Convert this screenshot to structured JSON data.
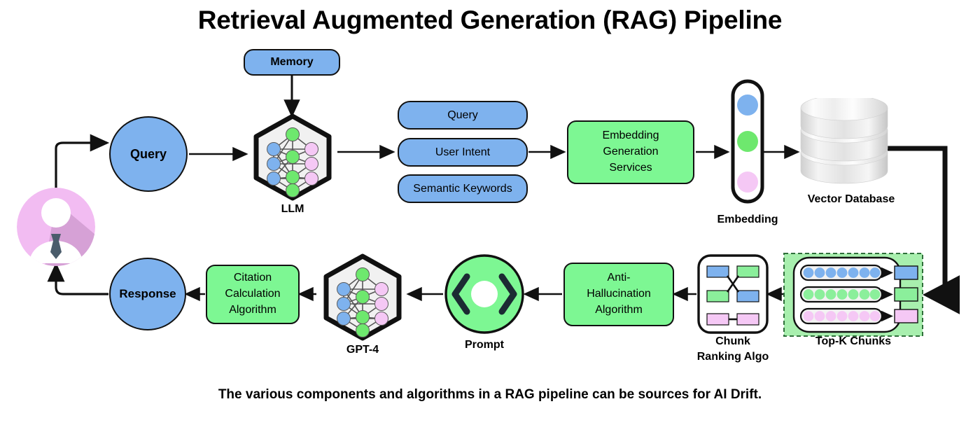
{
  "title": "Retrieval Augmented Generation (RAG) Pipeline",
  "caption": "The various components and algorithms in a RAG pipeline can be sources for AI Drift.",
  "colors": {
    "blue": "#7EB2EE",
    "green": "#7DF793",
    "panel_green": "#A8EFAE",
    "pink": "#F5C8F5",
    "avatar_pink": "#F2BCF2",
    "avatar_shadow": "#CF9BD0",
    "tie": "#4A5C6B",
    "stroke": "#111111",
    "hex_fill": "#F1F1F1"
  },
  "nodes": {
    "user": {
      "name": "user-avatar",
      "icon": "user-avatar-icon"
    },
    "query": {
      "label": "Query"
    },
    "memory": {
      "label": "Memory"
    },
    "llm": {
      "label": "LLM",
      "icon": "neural-network-icon"
    },
    "parsed": {
      "items": [
        {
          "label": "Query"
        },
        {
          "label": "User Intent"
        },
        {
          "label": "Semantic Keywords"
        }
      ]
    },
    "embedding_service": {
      "lines": [
        "Embedding",
        "Generation",
        "Services"
      ]
    },
    "embedding": {
      "label": "Embedding",
      "dots": [
        "blue",
        "green",
        "pink"
      ]
    },
    "vector_db": {
      "label": "Vector Database",
      "icon": "database-icon",
      "discs": 3
    },
    "topk": {
      "label": "Top-K Chunks",
      "rows": [
        {
          "color": "blue",
          "dots": 7
        },
        {
          "color": "green",
          "dots": 7
        },
        {
          "color": "pink",
          "dots": 7
        }
      ]
    },
    "chunk_ranking": {
      "label": "Chunk\nRanking Algo",
      "icon": "rank-swap-icon"
    },
    "anti_hallucination": {
      "lines": [
        "Anti-",
        "Hallucination",
        "Algorithm"
      ]
    },
    "prompt": {
      "label": "Prompt",
      "icon": "code-brackets-icon"
    },
    "gpt4": {
      "label": "GPT-4",
      "icon": "neural-network-icon"
    },
    "citation": {
      "lines": [
        "Citation",
        "Calculation",
        "Algorithm"
      ]
    },
    "response": {
      "label": "Response"
    }
  },
  "flow": {
    "edges": [
      {
        "from": "user",
        "to": "query"
      },
      {
        "from": "memory",
        "to": "llm"
      },
      {
        "from": "query",
        "to": "llm"
      },
      {
        "from": "llm",
        "to": "parsed"
      },
      {
        "from": "parsed",
        "to": "embedding_service"
      },
      {
        "from": "embedding_service",
        "to": "embedding"
      },
      {
        "from": "embedding",
        "to": "vector_db"
      },
      {
        "from": "vector_db",
        "to": "topk"
      },
      {
        "from": "topk",
        "to": "chunk_ranking"
      },
      {
        "from": "chunk_ranking",
        "to": "anti_hallucination"
      },
      {
        "from": "anti_hallucination",
        "to": "prompt"
      },
      {
        "from": "prompt",
        "to": "gpt4"
      },
      {
        "from": "gpt4",
        "to": "citation"
      },
      {
        "from": "citation",
        "to": "response"
      },
      {
        "from": "response",
        "to": "user"
      }
    ]
  }
}
